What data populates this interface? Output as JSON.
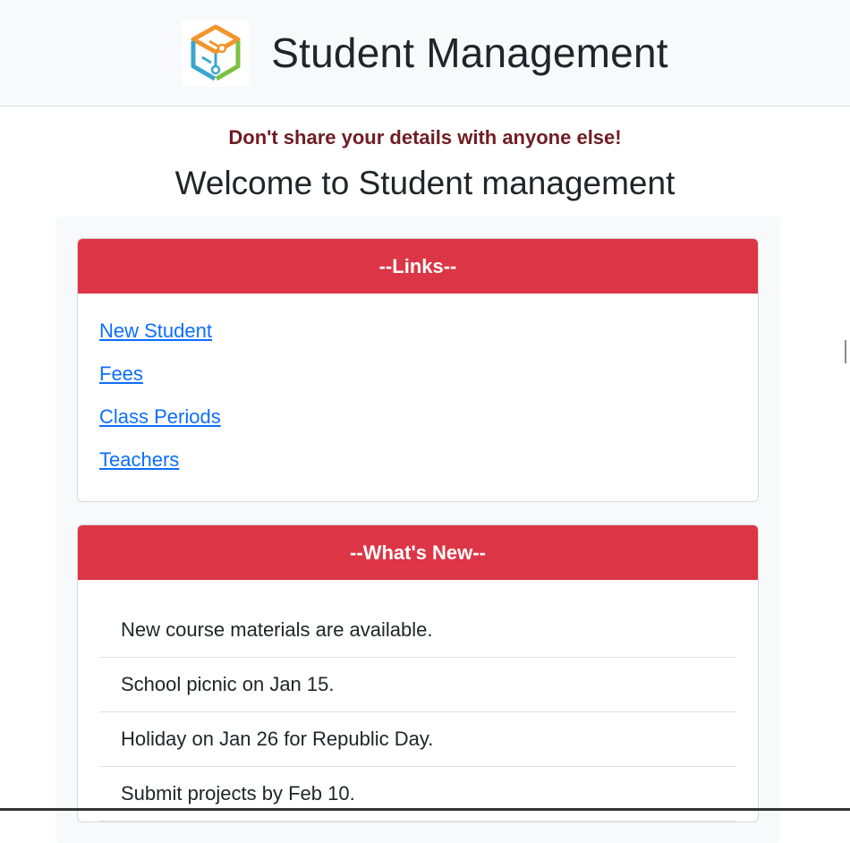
{
  "header": {
    "title": "Student Management",
    "logo_icon": "cube-logo-icon"
  },
  "warning": "Don't share your details with anyone else!",
  "welcome": "Welcome to Student management",
  "links_card": {
    "title": "--Links--",
    "items": [
      "New Student",
      "Fees",
      "Class Periods",
      "Teachers"
    ]
  },
  "news_card": {
    "title": "--What's New--",
    "items": [
      "New course materials are available.",
      "School picnic on Jan 15.",
      "Holiday on Jan 26 for Republic Day.",
      "Submit projects by Feb 10."
    ]
  },
  "colors": {
    "accent": "#dc3545",
    "link": "#0d6efd",
    "warning_text": "#6f1d23"
  }
}
